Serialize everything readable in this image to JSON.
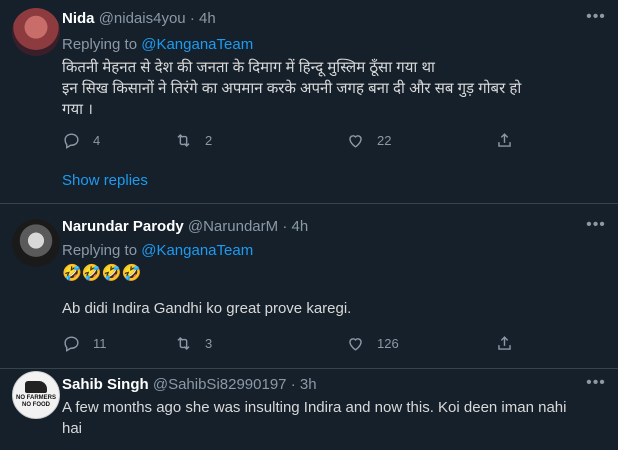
{
  "tweets": [
    {
      "name": "Nida",
      "handle": "@nidais4you",
      "time": "4h",
      "replying_prefix": "Replying to ",
      "replying_to": "@KanganaTeam",
      "body_lines": [
        "कितनी मेहनत से देश की जनता के दिमाग में हिन्दू मुस्लिम ठूँसा गया था",
        "इन सिख किसानों ने तिरंगे का अपमान करके अपनी जगह बना दी और सब गुड़ गोबर हो",
        "गया ।"
      ],
      "replies": "4",
      "retweets": "2",
      "likes": "22",
      "show_replies": "Show replies"
    },
    {
      "name": "Narundar Parody",
      "handle": "@NarundarM",
      "time": "4h",
      "replying_prefix": "Replying to ",
      "replying_to": "@KanganaTeam",
      "emojis": "🤣🤣🤣🤣",
      "body": "Ab didi Indira Gandhi ko great prove karegi.",
      "replies": "11",
      "retweets": "3",
      "likes": "126"
    },
    {
      "name": "Sahib Singh",
      "handle": "@SahibSi82990197",
      "time": "3h",
      "avatar_text": [
        "NO FARMERS",
        "NO FOOD"
      ],
      "body_lines": [
        "A few months ago she was insulting Indira and now this. Koi deen iman nahi",
        "hai"
      ]
    }
  ],
  "separator": "·",
  "icons": [
    "reply-icon",
    "retweet-icon",
    "like-icon",
    "share-icon",
    "more-icon"
  ],
  "colors": {
    "background": "#15202b",
    "link": "#1d9bf0",
    "muted": "#8b98a5",
    "text": "#d9d9d9"
  }
}
